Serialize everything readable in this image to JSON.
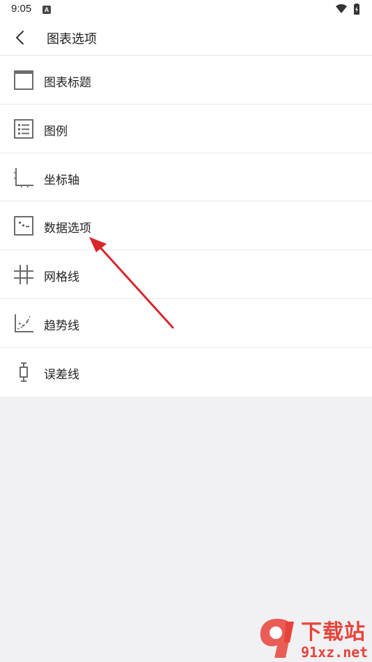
{
  "status_bar": {
    "time": "9:05",
    "notification_badge": "A",
    "wifi_icon": "wifi-icon",
    "battery_icon": "battery-charging-icon"
  },
  "header": {
    "title": "图表选项",
    "back_icon": "chevron-left-icon"
  },
  "menu": {
    "items": [
      {
        "label": "图表标题",
        "icon": "chart-title-icon"
      },
      {
        "label": "图例",
        "icon": "legend-list-icon"
      },
      {
        "label": "坐标轴",
        "icon": "axis-icon"
      },
      {
        "label": "数据选项",
        "icon": "data-options-icon"
      },
      {
        "label": "网格线",
        "icon": "gridlines-icon"
      },
      {
        "label": "趋势线",
        "icon": "trendline-icon"
      },
      {
        "label": "误差线",
        "icon": "error-bar-icon"
      }
    ]
  },
  "annotation": {
    "arrow_color": "#d9262b",
    "target": "数据选项"
  },
  "watermark": {
    "brand_top": "下载站",
    "brand_bottom": "91xz.net",
    "color": "#e8433a"
  }
}
